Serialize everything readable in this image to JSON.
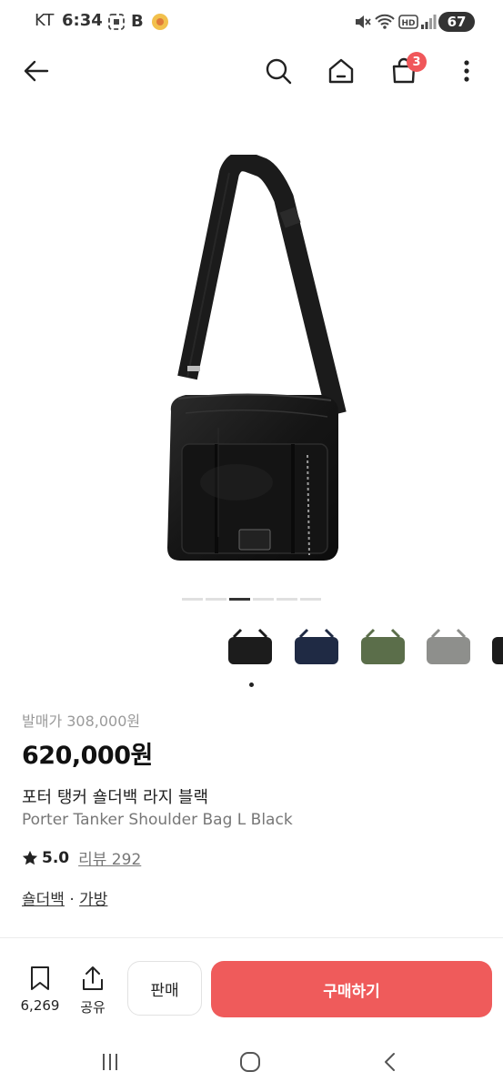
{
  "status_bar": {
    "carrier": "KT",
    "time": "6:34",
    "app_badge": "B",
    "battery": "67"
  },
  "header": {
    "cart_count": "3"
  },
  "gallery": {
    "page_count": 6,
    "active_page": 3,
    "thumbnail_colors": [
      "#1c1c1c",
      "#1f2a44",
      "#5b6e4a",
      "#8e8f8c",
      "#1c1c1c"
    ]
  },
  "product": {
    "release_price": "발매가 308,000원",
    "price": "620,000원",
    "title_ko": "포터 탱커 숄더백 라지 블랙",
    "title_en": "Porter Tanker Shoulder Bag L Black",
    "rating": "5.0",
    "review_label": "리뷰 292",
    "categories": [
      "숄더백",
      "가방"
    ],
    "category_separator": " · "
  },
  "bottom_bar": {
    "wish_count": "6,269",
    "share_label": "공유",
    "sell_label": "판매",
    "buy_label": "구매하기"
  },
  "colors": {
    "accent": "#ef5b5b",
    "badge": "#f0575a"
  }
}
